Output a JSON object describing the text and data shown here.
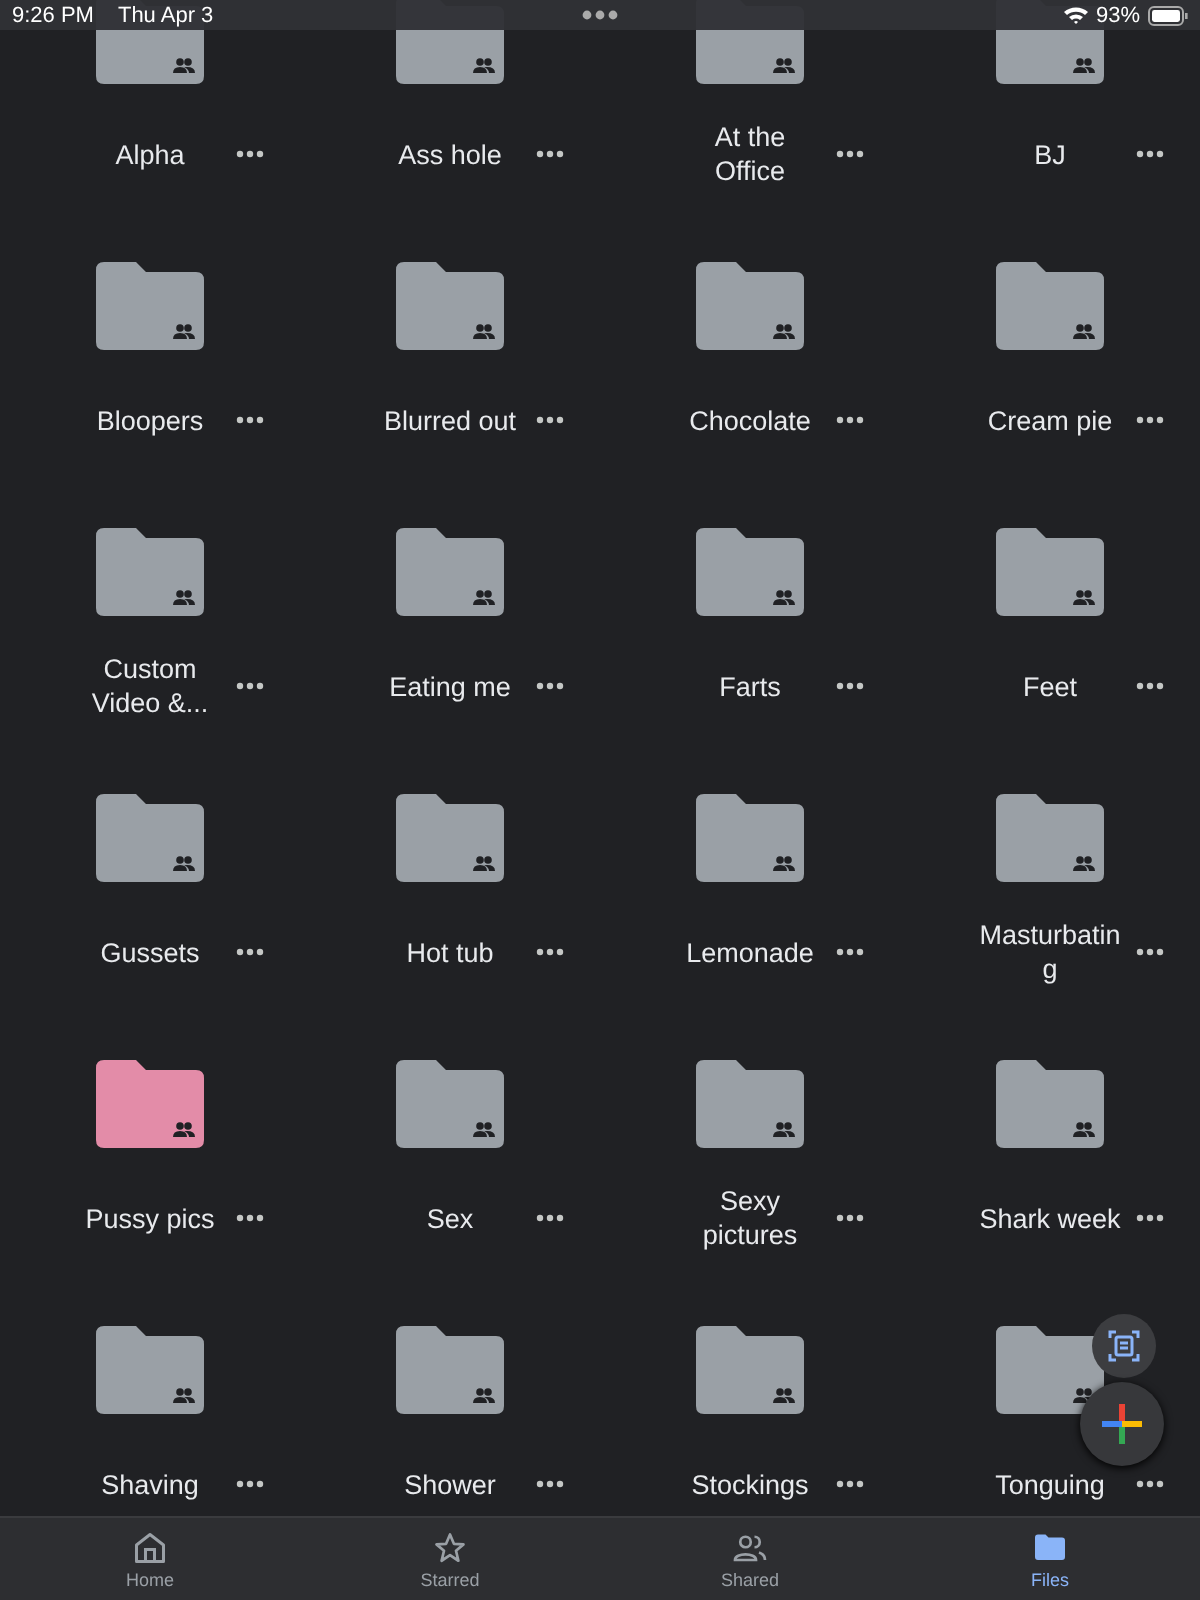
{
  "status_bar": {
    "time": "9:26 PM",
    "date": "Thu Apr 3",
    "battery": "93%"
  },
  "folders": [
    {
      "name": "Alpha",
      "color": "#9aa0a6"
    },
    {
      "name": "Ass hole",
      "color": "#9aa0a6"
    },
    {
      "name": "At the Office",
      "color": "#9aa0a6"
    },
    {
      "name": "BJ",
      "color": "#9aa0a6"
    },
    {
      "name": "Bloopers",
      "color": "#9aa0a6"
    },
    {
      "name": "Blurred out",
      "color": "#9aa0a6"
    },
    {
      "name": "Chocolate",
      "color": "#9aa0a6"
    },
    {
      "name": "Cream pie",
      "color": "#9aa0a6"
    },
    {
      "name": "Custom Video &...",
      "color": "#9aa0a6"
    },
    {
      "name": "Eating me",
      "color": "#9aa0a6"
    },
    {
      "name": "Farts",
      "color": "#9aa0a6"
    },
    {
      "name": "Feet",
      "color": "#9aa0a6"
    },
    {
      "name": "Gussets",
      "color": "#9aa0a6"
    },
    {
      "name": "Hot tub",
      "color": "#9aa0a6"
    },
    {
      "name": "Lemonade",
      "color": "#9aa0a6"
    },
    {
      "name": "Masturbating",
      "color": "#9aa0a6"
    },
    {
      "name": "Pussy pics",
      "color": "#e38ca8"
    },
    {
      "name": "Sex",
      "color": "#9aa0a6"
    },
    {
      "name": "Sexy pictures",
      "color": "#9aa0a6"
    },
    {
      "name": "Shark week",
      "color": "#9aa0a6"
    },
    {
      "name": "Shaving",
      "color": "#9aa0a6"
    },
    {
      "name": "Shower",
      "color": "#9aa0a6"
    },
    {
      "name": "Stockings",
      "color": "#9aa0a6"
    },
    {
      "name": "Tonguing",
      "color": "#9aa0a6"
    }
  ],
  "bottom_nav": [
    {
      "label": "Home",
      "kind": "home",
      "selected": false
    },
    {
      "label": "Starred",
      "kind": "star",
      "selected": false
    },
    {
      "label": "Shared",
      "kind": "shared",
      "selected": false
    },
    {
      "label": "Files",
      "kind": "files",
      "selected": true
    }
  ]
}
